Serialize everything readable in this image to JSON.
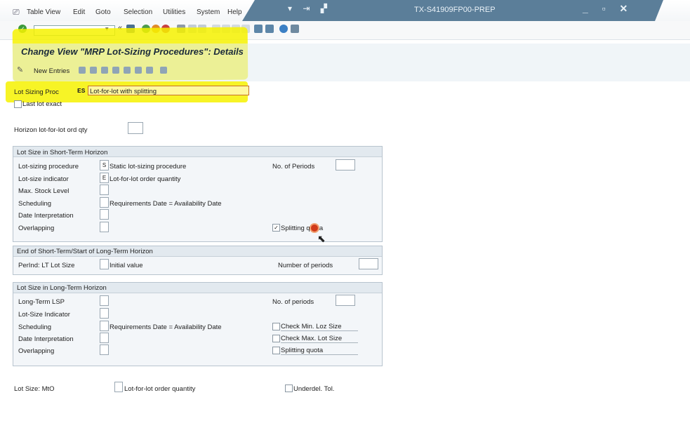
{
  "menubar": {
    "items": [
      "Table View",
      "Edit",
      "Goto",
      "Selection",
      "Utilities",
      "System",
      "Help"
    ]
  },
  "window": {
    "title": "TX-S41909FP00-PREP"
  },
  "header": {
    "title": "Change View \"MRP Lot-Sizing Procedures\": Details"
  },
  "app_toolbar": {
    "new_entries": "New Entries"
  },
  "form": {
    "lot_sizing_proc_label": "Lot Sizing Proc",
    "lot_sizing_proc_code": "ES",
    "lot_sizing_proc_desc": "Lot-for-lot with splitting",
    "last_lot_exact_label": "Last lot exact",
    "horizon_label": "Horizon  lot-for-lot ord qty"
  },
  "short_term": {
    "title": "Lot Size in Short-Term Horizon",
    "rows": [
      {
        "label": "Lot-sizing procedure",
        "code": "S",
        "desc": "Static lot-sizing procedure"
      },
      {
        "label": "Lot-size indicator",
        "code": "E",
        "desc": "Lot-for-lot order quantity"
      },
      {
        "label": "Max. Stock Level",
        "code": "",
        "desc": ""
      },
      {
        "label": "Scheduling",
        "code": "",
        "desc": "Requirements Date = Availability Date"
      },
      {
        "label": "Date Interpretation",
        "code": "",
        "desc": ""
      },
      {
        "label": "Overlapping",
        "code": "",
        "desc": ""
      }
    ],
    "periods_label": "No. of Periods",
    "splitting_quota_label": "Splitting quota",
    "splitting_quota_checked": true
  },
  "transition": {
    "title": "End of Short-Term/Start of Long-Term Horizon",
    "perind_label": "PerInd: LT Lot Size",
    "perind_desc": "Initial value",
    "periods_label": "Number of periods"
  },
  "long_term": {
    "title": "Lot Size in Long-Term Horizon",
    "rows": [
      {
        "label": "Long-Term LSP",
        "desc": ""
      },
      {
        "label": "Lot-Size Indicator",
        "desc": ""
      },
      {
        "label": "Scheduling",
        "desc": "Requirements Date = Availability Date"
      },
      {
        "label": "Date Interpretation",
        "desc": ""
      },
      {
        "label": "Overlapping",
        "desc": ""
      }
    ],
    "periods_label": "No. of periods",
    "check_min_label": "Check Min. Loz Size",
    "check_max_label": "Check Max. Lot Size",
    "splitting_quota_label": "Splitting quota"
  },
  "mto": {
    "label": "Lot Size: MtO",
    "desc": "Lot-for-lot order quantity",
    "underdel_label": "Underdel. Tol."
  }
}
